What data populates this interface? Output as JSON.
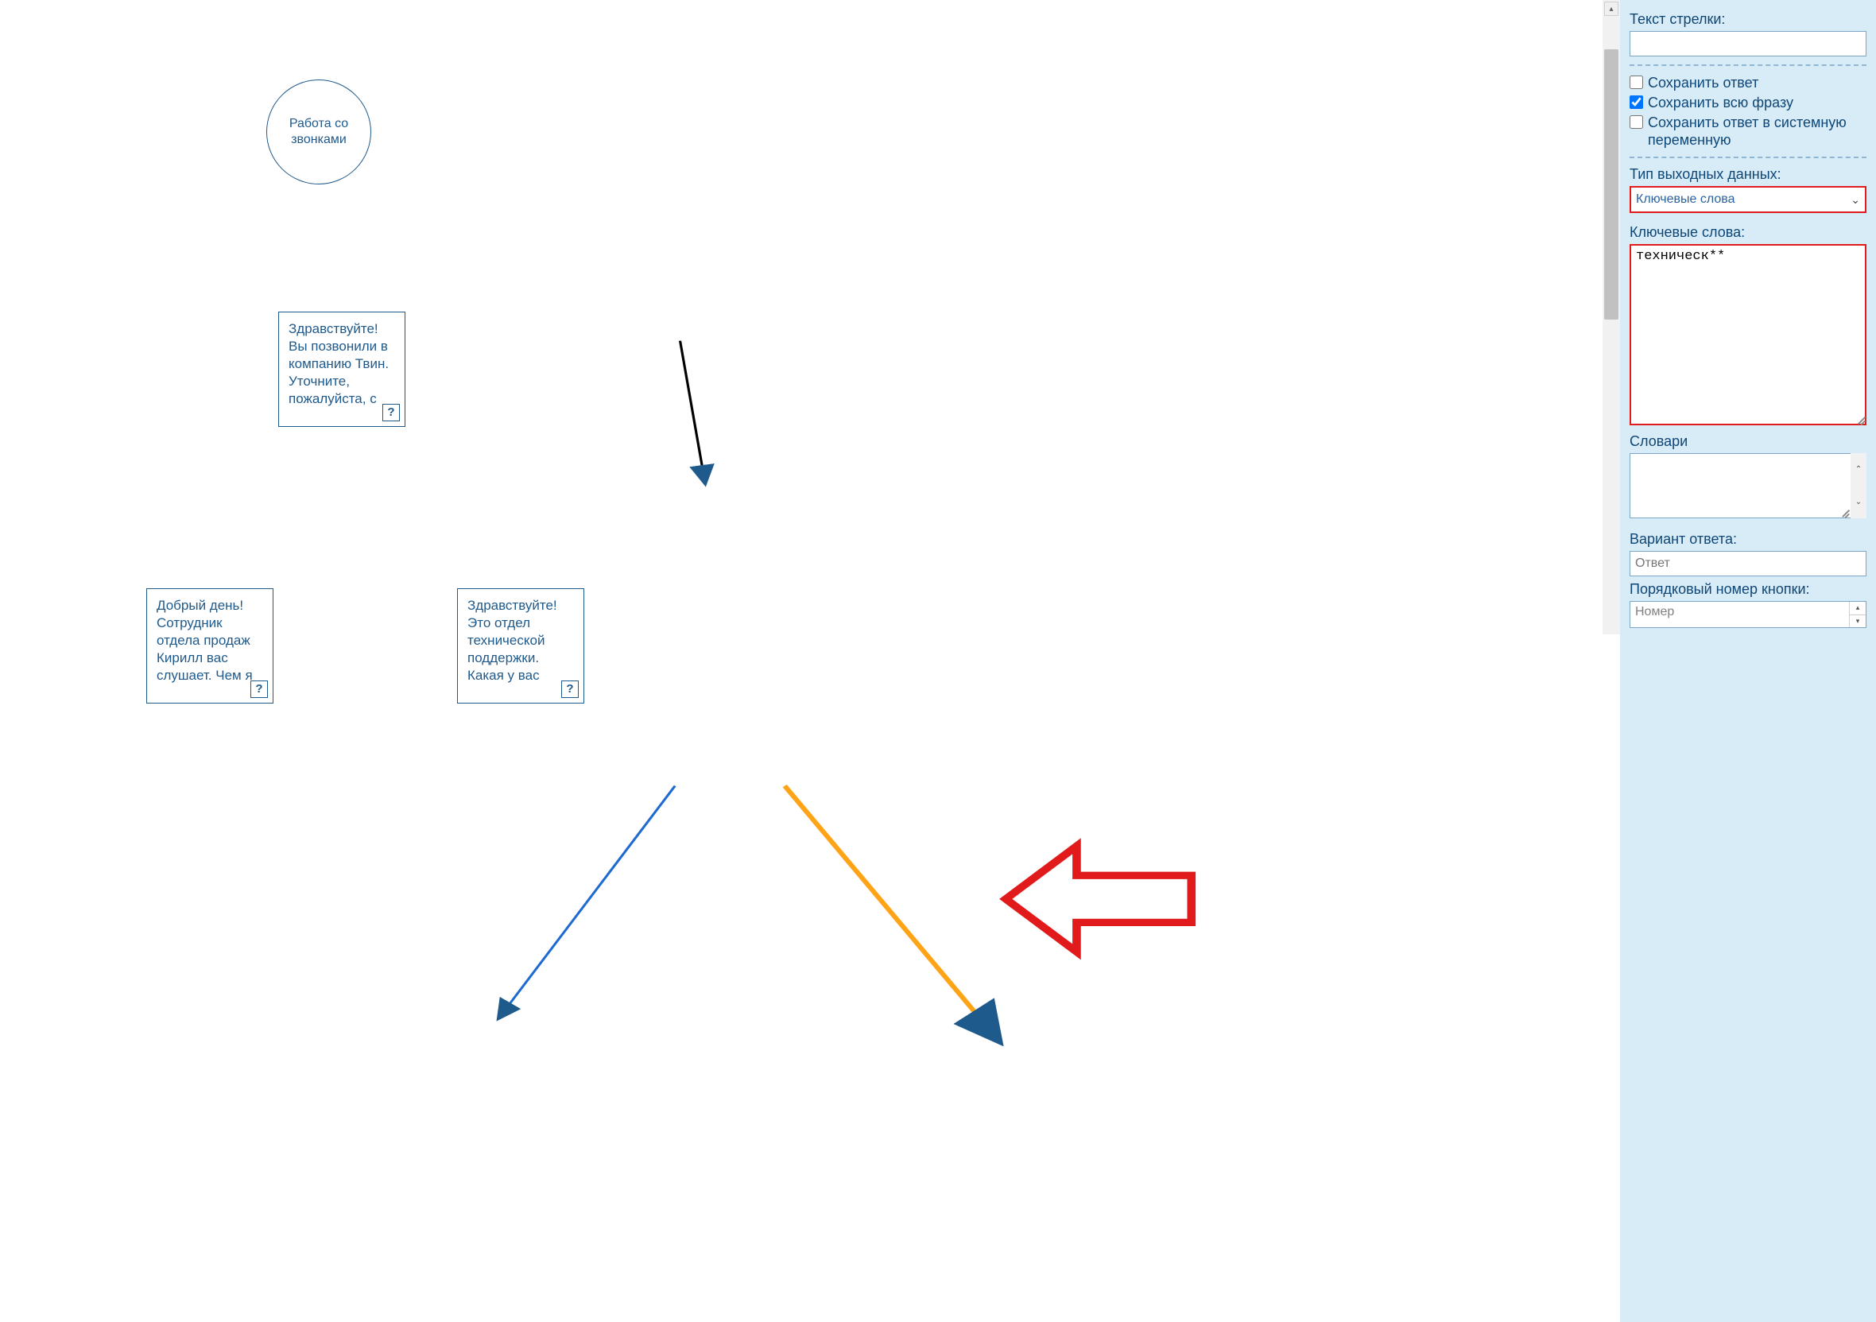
{
  "diagram": {
    "start_node": "Работа со звонками",
    "greeting_node": "Здравствуйте! Вы позвонили в компанию Твин. Уточните, пожалуйста, с",
    "sales_node": "Добрый день! Сотрудник отдела продаж Кирилл вас слушает. Чем я",
    "support_node": "Здравствуйте! Это отдел технической поддержки. Какая у вас",
    "q_badge": "?"
  },
  "panel": {
    "arrow_text_label": "Текст стрелки:",
    "arrow_text_value": "",
    "cb_save_answer": "Сохранить ответ",
    "cb_save_phrase": "Сохранить всю фразу",
    "cb_save_sysvar": "Сохранить ответ в системную переменную",
    "output_type_label": "Тип выходных данных:",
    "output_type_value": "Ключевые слова",
    "keywords_label": "Ключевые слова:",
    "keywords_value": "техническ**",
    "dictionaries_label": "Словари",
    "dictionaries_value": "",
    "answer_variant_label": "Вариант ответа:",
    "answer_variant_placeholder": "Ответ",
    "button_order_label": "Порядковый номер кнопки:",
    "button_order_placeholder": "Номер"
  },
  "checkbox_states": {
    "save_answer": false,
    "save_phrase": true,
    "save_sysvar": false
  }
}
